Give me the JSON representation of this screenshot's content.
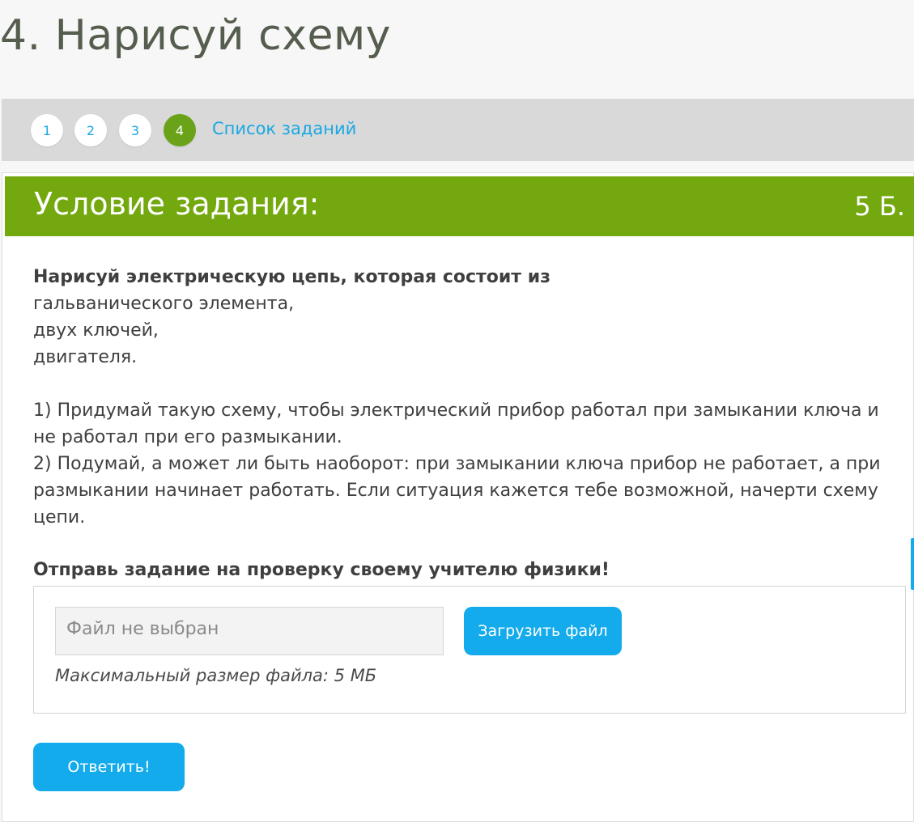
{
  "page": {
    "title": "4. Нарисуй схему"
  },
  "nav": {
    "items": [
      {
        "label": "1",
        "active": false
      },
      {
        "label": "2",
        "active": false
      },
      {
        "label": "3",
        "active": false
      },
      {
        "label": "4",
        "active": true
      }
    ],
    "task_list_label": "Список заданий"
  },
  "panel": {
    "title": "Условие задания:",
    "points": "5 Б.",
    "intro_bold": "Нарисуй электрическую цепь, которая состоит из",
    "components": [
      "гальванического элемента,",
      "двух ключей,",
      "двигателя."
    ],
    "task_1": "1) Придумай такую схему, чтобы электрический прибор работал при замыкании ключа и не работал при его размыкании.",
    "task_2": "2) Подумай, а может ли быть наоборот: при замыкании ключа прибор не работает, а при размыкании начинает работать. Если ситуация кажется тебе возможной, начерти схему цепи.",
    "submit_heading": "Отправь задание на проверку своему учителю физики!"
  },
  "upload": {
    "file_status": "Файл не выбран",
    "upload_button": "Загрузить файл",
    "max_size": "Максимальный размер файла: 5 МБ"
  },
  "answer_button": "Ответить!",
  "colors": {
    "accent_green": "#73a80e",
    "accent_blue": "#13abec",
    "nav_background": "#d9d9d9"
  }
}
